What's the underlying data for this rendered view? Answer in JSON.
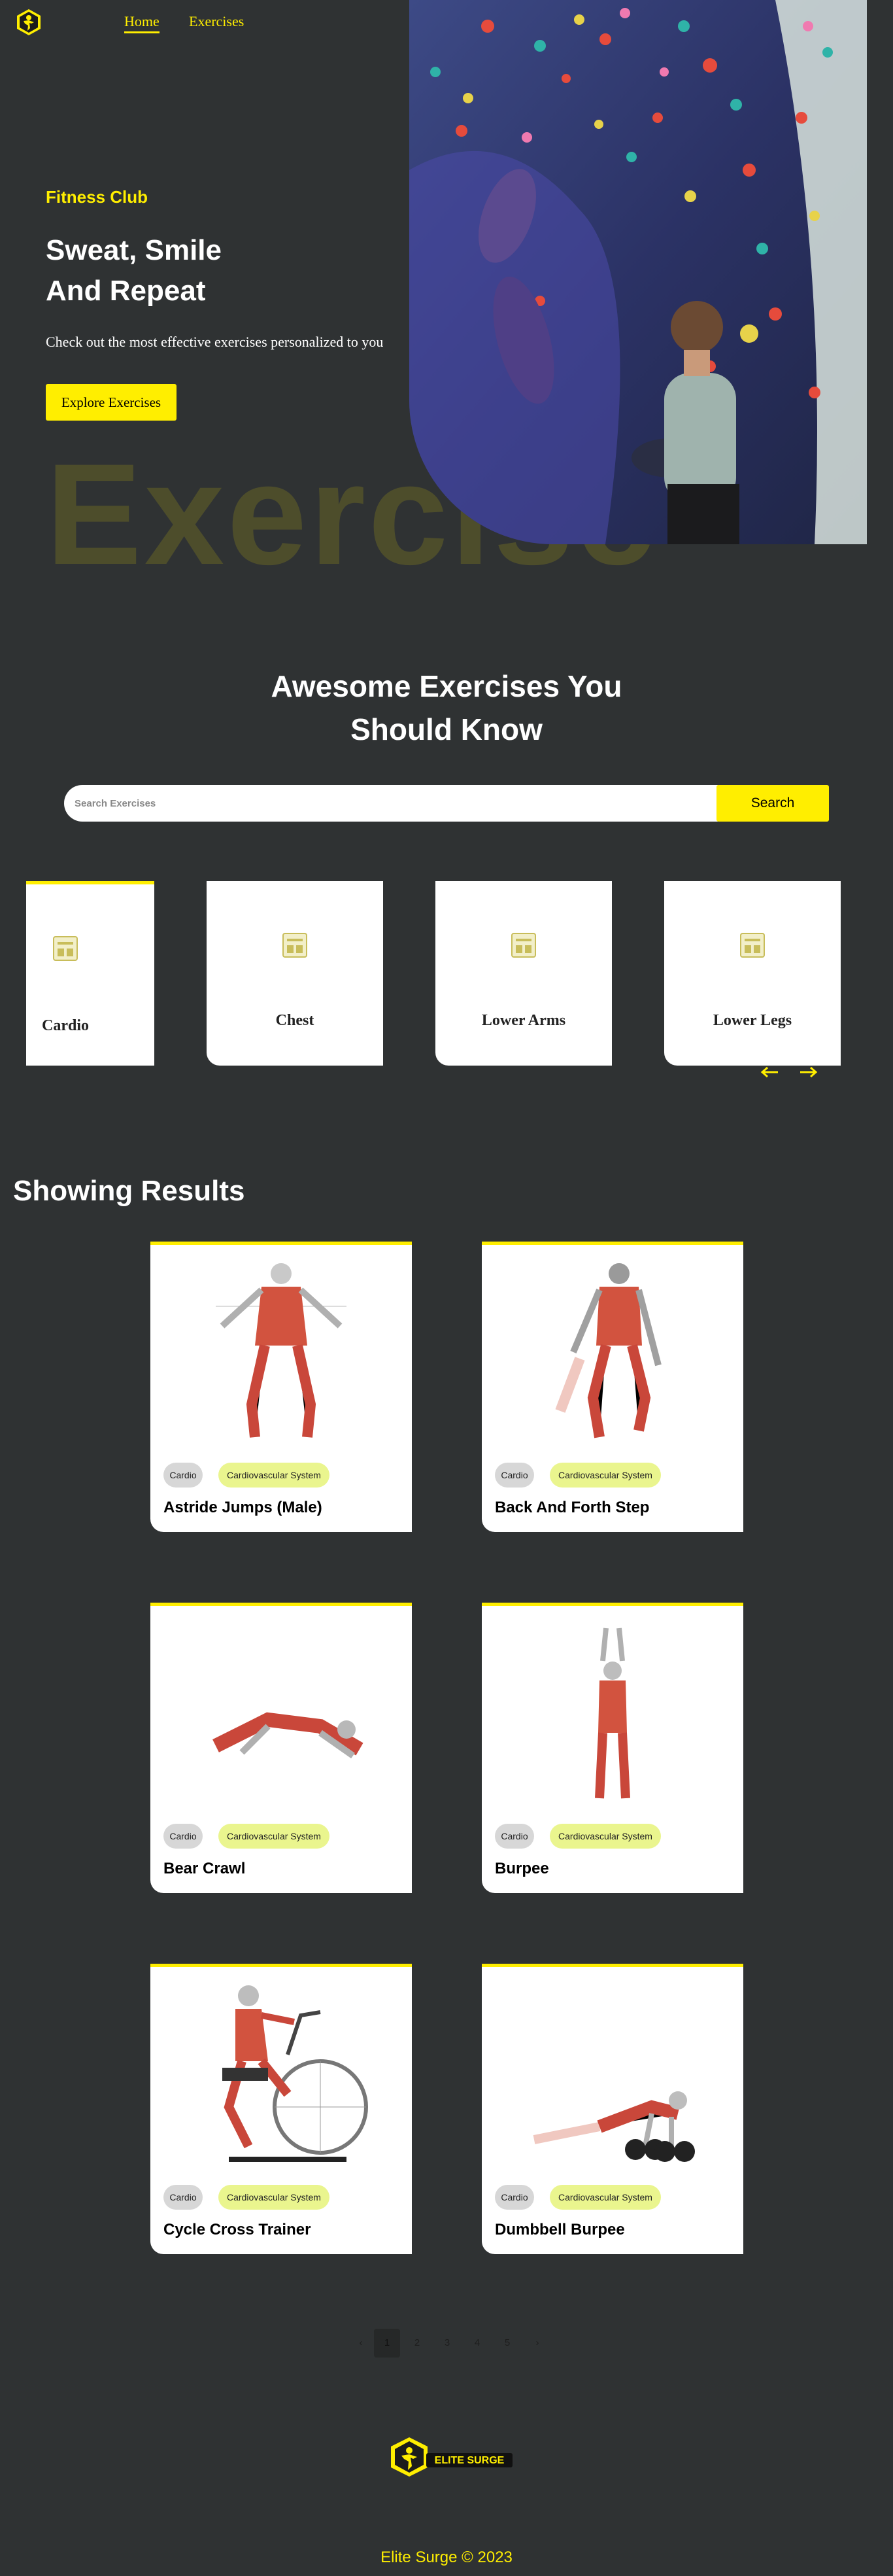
{
  "nav": {
    "home": "Home",
    "exercises": "Exercises"
  },
  "hero": {
    "subtitle": "Fitness Club",
    "title_line1": "Sweat, Smile",
    "title_line2": "And Repeat",
    "description": "Check out the most effective exercises personalized to you",
    "button": "Explore Exercises",
    "bg_text": "Exercise"
  },
  "search": {
    "title_line1": "Awesome Exercises You",
    "title_line2": "Should Know",
    "placeholder": "Search Exercises",
    "button": "Search"
  },
  "body_parts": [
    "Cardio",
    "Chest",
    "Lower Arms",
    "Lower Legs"
  ],
  "results": {
    "title": "Showing Results",
    "exercises": [
      {
        "name": "Astride Jumps (Male)",
        "body_part": "Cardio",
        "target": "Cardiovascular System"
      },
      {
        "name": "Back And Forth Step",
        "body_part": "Cardio",
        "target": "Cardiovascular System"
      },
      {
        "name": "Bear Crawl",
        "body_part": "Cardio",
        "target": "Cardiovascular System"
      },
      {
        "name": "Burpee",
        "body_part": "Cardio",
        "target": "Cardiovascular System"
      },
      {
        "name": "Cycle Cross Trainer",
        "body_part": "Cardio",
        "target": "Cardiovascular System"
      },
      {
        "name": "Dumbbell Burpee",
        "body_part": "Cardio",
        "target": "Cardiovascular System"
      }
    ]
  },
  "pagination": {
    "prev": "‹",
    "pages": [
      "1",
      "2",
      "3",
      "4",
      "5"
    ],
    "next": "›",
    "current": "1"
  },
  "footer": {
    "logo_text": "ELITE SURGE",
    "copyright": "Elite Surge © 2023"
  },
  "colors": {
    "accent": "#ffee00",
    "background": "#2f3233",
    "pill_target": "#eaf58e",
    "pill_part": "#d7d7d7"
  }
}
